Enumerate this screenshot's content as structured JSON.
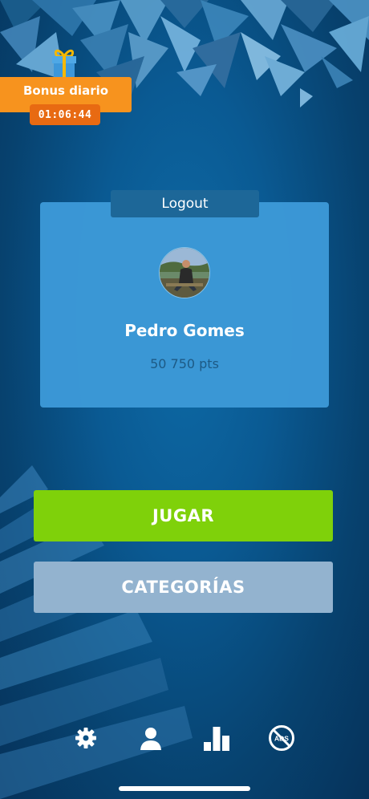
{
  "bonus": {
    "label": "Bonus diario",
    "timer": "01:06:44"
  },
  "profile": {
    "logout_label": "Logout",
    "name": "Pedro Gomes",
    "points": "50 750 pts"
  },
  "actions": {
    "play_label": "JUGAR",
    "categories_label": "CATEGORÍAS"
  },
  "nav": {
    "items": [
      {
        "icon": "gear-icon"
      },
      {
        "icon": "user-icon"
      },
      {
        "icon": "leaderboard-icon"
      },
      {
        "icon": "no-ads-icon",
        "text": "ADS"
      }
    ]
  },
  "colors": {
    "background": "#0a5a93",
    "card": "#3b98d6",
    "logout_tab": "#1d6798",
    "play": "#7fd10a",
    "categories": "#93b3cf",
    "bonus": "#f7931e",
    "timer": "#e86a12"
  }
}
